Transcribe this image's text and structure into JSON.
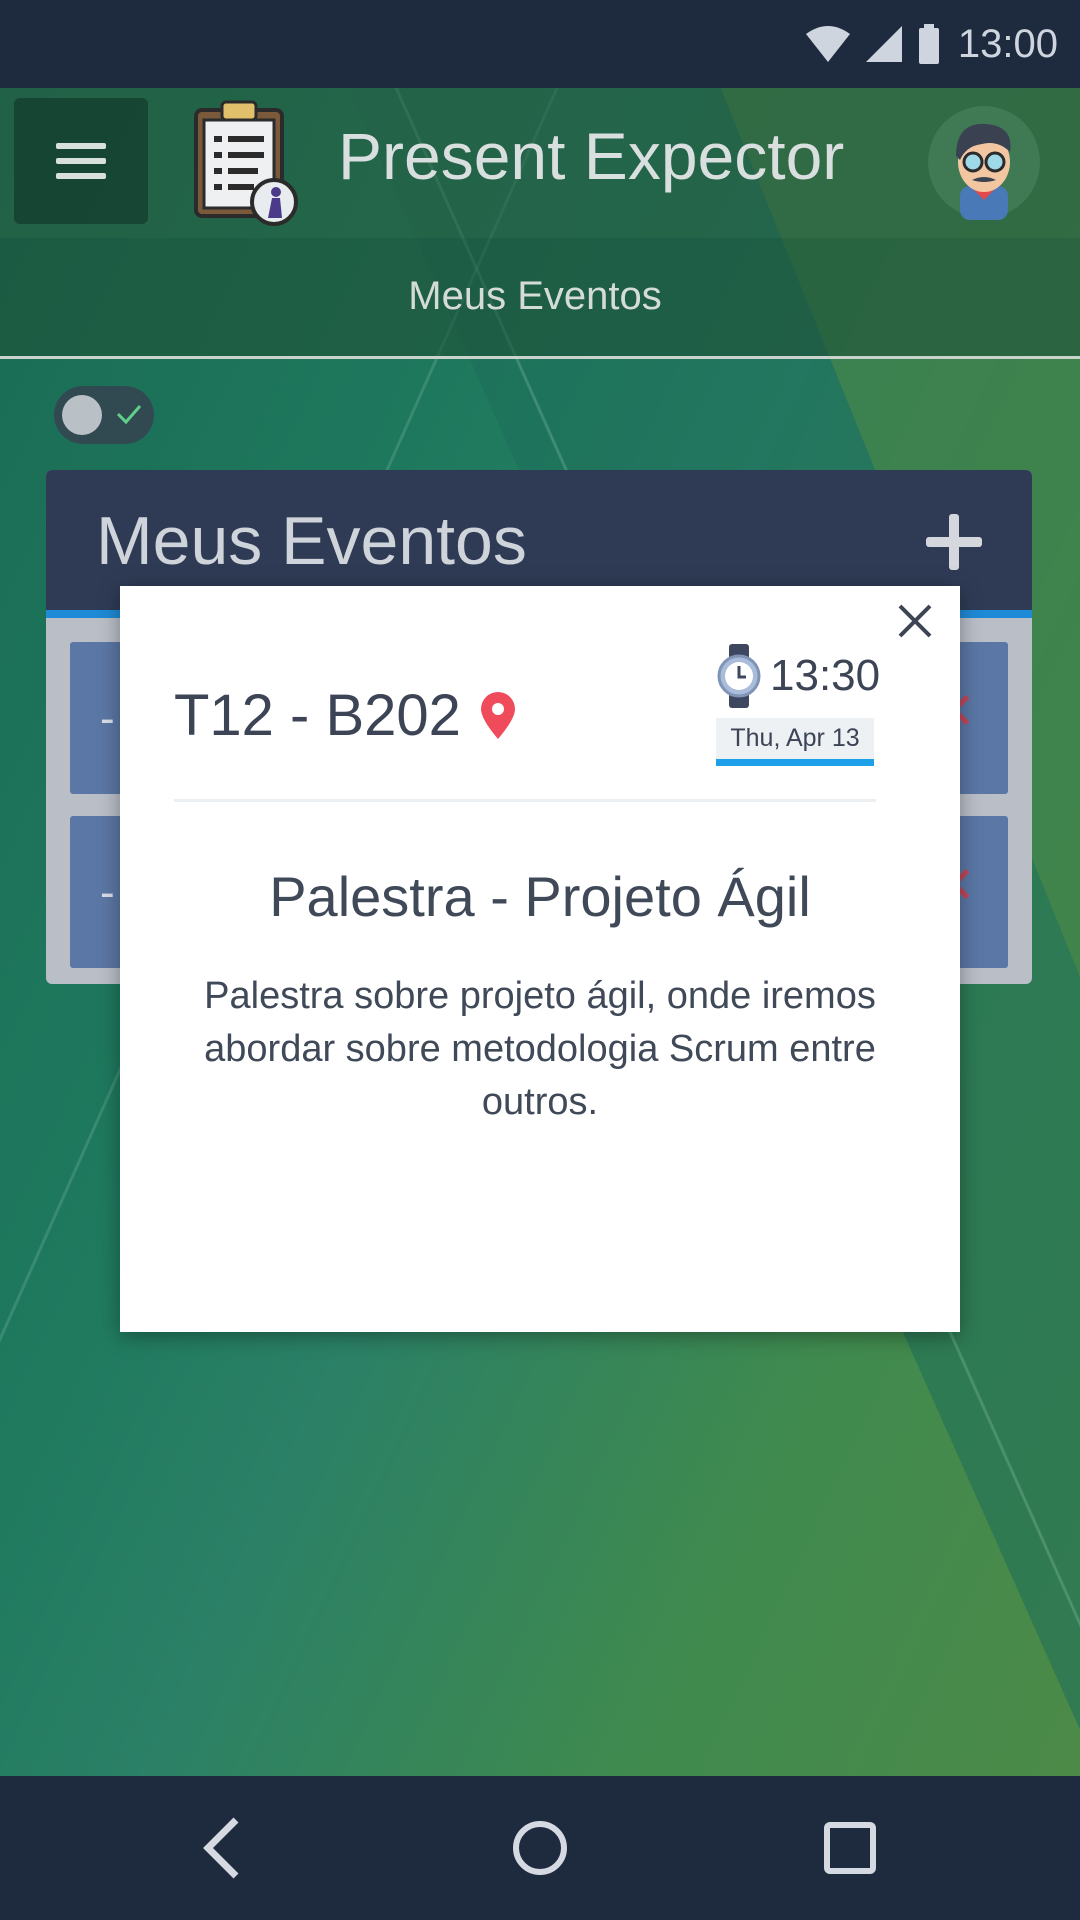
{
  "status_bar": {
    "time": "13:00"
  },
  "app_bar": {
    "title": "Present Expector"
  },
  "tabs": [
    {
      "label": "Meus Eventos"
    }
  ],
  "events_card": {
    "title": "Meus Eventos"
  },
  "modal": {
    "room": "T12 - B202",
    "time": "13:30",
    "date": "Thu, Apr 13",
    "event_name": "Palestra - Projeto Ágil",
    "description": "Palestra sobre projeto ágil, onde iremos abordar sobre metodologia Scrum entre outros."
  },
  "icons": {
    "menu": "menu-icon",
    "logo": "clipboard-icon",
    "avatar": "user-avatar",
    "add": "plus-icon",
    "close": "close-icon",
    "location": "location-pin-icon",
    "clock": "watch-icon",
    "back": "back-icon",
    "home": "home-icon",
    "recents": "recents-icon"
  },
  "colors": {
    "accent": "#1ea0e8",
    "header": "#2f3b55",
    "pin": "#ef4b5a"
  }
}
